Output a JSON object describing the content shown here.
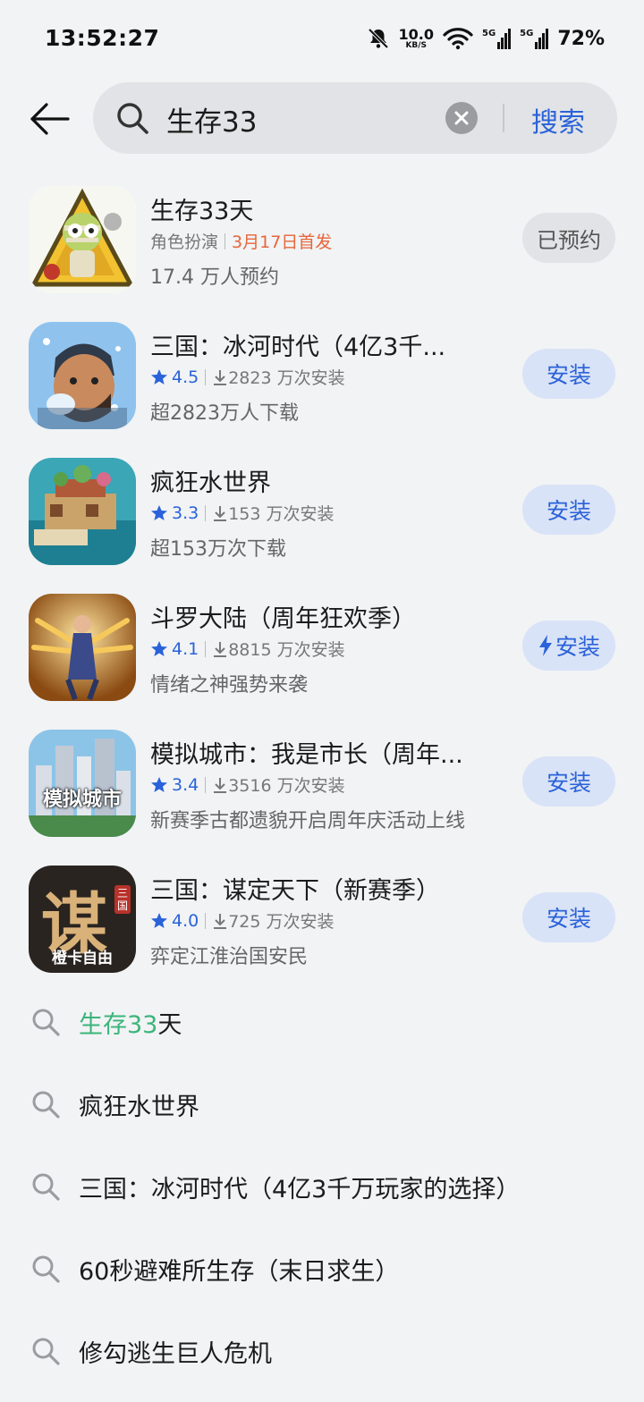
{
  "status_bar": {
    "time": "13:52:27",
    "net_speed_value": "10.0",
    "net_speed_unit": "KB/S",
    "signal_label_1": "5G",
    "signal_label_2": "5G",
    "battery": "72%"
  },
  "search": {
    "query": "生存33",
    "button_label": "搜索"
  },
  "apps": [
    {
      "title": "生存33天",
      "category": "角色扮演",
      "release": "3月17日首发",
      "desc": "17.4 万人预约",
      "action": "已预约"
    },
    {
      "title": "三国：冰河时代（4亿3千...",
      "rating": "4.5",
      "installs": "2823 万次安装",
      "desc": "超2823万人下载",
      "action": "安装"
    },
    {
      "title": "疯狂水世界",
      "rating": "3.3",
      "installs": "153 万次安装",
      "desc": "超153万次下载",
      "action": "安装"
    },
    {
      "title": "斗罗大陆（周年狂欢季）",
      "rating": "4.1",
      "installs": "8815 万次安装",
      "desc": "情绪之神强势来袭",
      "action": "安装"
    },
    {
      "title": "模拟城市：我是市长（周年...",
      "rating": "3.4",
      "installs": "3516 万次安装",
      "desc": "新赛季古都遗貌开启周年庆活动上线",
      "action": "安装",
      "icon_text": "模拟城市"
    },
    {
      "title": "三国：谋定天下（新赛季）",
      "rating": "4.0",
      "installs": "725 万次安装",
      "desc": "弈定江淮治国安民",
      "action": "安装",
      "icon_text": "谋",
      "icon_subtext": "橙卡自由",
      "icon_badge": "三国"
    }
  ],
  "suggestions": [
    {
      "highlight": "生存33",
      "rest": "天"
    },
    {
      "highlight": "",
      "rest": "疯狂水世界"
    },
    {
      "highlight": "",
      "rest": "三国：冰河时代（4亿3千万玩家的选择）"
    },
    {
      "highlight": "",
      "rest": "60秒避难所生存（末日求生）"
    },
    {
      "highlight": "",
      "rest": "修勾逃生巨人危机"
    }
  ],
  "colors": {
    "accent": "#2a62d9",
    "release_orange": "#e8663a",
    "highlight_green": "#3bb57a",
    "background": "#f1f3f5"
  }
}
